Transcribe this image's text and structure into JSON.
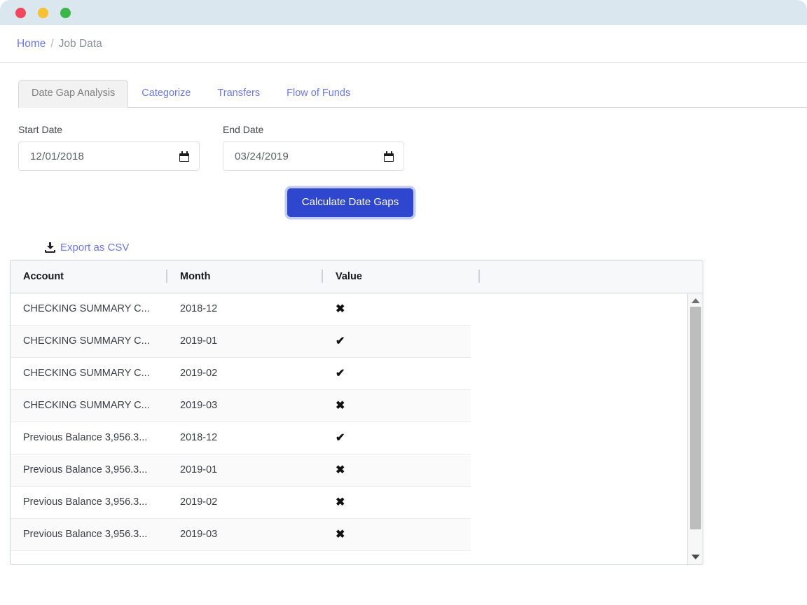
{
  "window": {
    "traffic_lights": [
      "close-red",
      "minimize-yellow",
      "maximize-green"
    ]
  },
  "breadcrumb": {
    "home_label": "Home",
    "separator": "/",
    "current_label": "Job Data"
  },
  "tabs": [
    {
      "label": "Date Gap Analysis",
      "active": true
    },
    {
      "label": "Categorize",
      "active": false
    },
    {
      "label": "Transfers",
      "active": false
    },
    {
      "label": "Flow of Funds",
      "active": false
    }
  ],
  "form": {
    "start_date": {
      "label": "Start Date",
      "value": "12/01/2018",
      "icon": "calendar-icon"
    },
    "end_date": {
      "label": "End Date",
      "value": "03/24/2019",
      "icon": "calendar-icon"
    },
    "submit_label": "Calculate Date Gaps"
  },
  "export": {
    "label": "Export as CSV",
    "icon": "download-icon"
  },
  "table": {
    "columns": [
      "Account",
      "Month",
      "Value"
    ],
    "rows": [
      {
        "account": "CHECKING SUMMARY C...",
        "month": "2018-12",
        "value": "✖"
      },
      {
        "account": "CHECKING SUMMARY C...",
        "month": "2019-01",
        "value": "✔"
      },
      {
        "account": "CHECKING SUMMARY C...",
        "month": "2019-02",
        "value": "✔"
      },
      {
        "account": "CHECKING SUMMARY C...",
        "month": "2019-03",
        "value": "✖"
      },
      {
        "account": "Previous Balance 3,956.3...",
        "month": "2018-12",
        "value": "✔"
      },
      {
        "account": "Previous Balance 3,956.3...",
        "month": "2019-01",
        "value": "✖"
      },
      {
        "account": "Previous Balance 3,956.3...",
        "month": "2019-02",
        "value": "✖"
      },
      {
        "account": "Previous Balance 3,956.3...",
        "month": "2019-03",
        "value": "✖"
      }
    ]
  },
  "colors": {
    "titlebar": "#dbe7ee",
    "link": "#6b78e8",
    "primary_button": "#2f46cf",
    "active_tab_bg": "#f2f2f2",
    "table_header_bg": "#f7f8f9",
    "row_alt_bg": "#fafafa"
  }
}
